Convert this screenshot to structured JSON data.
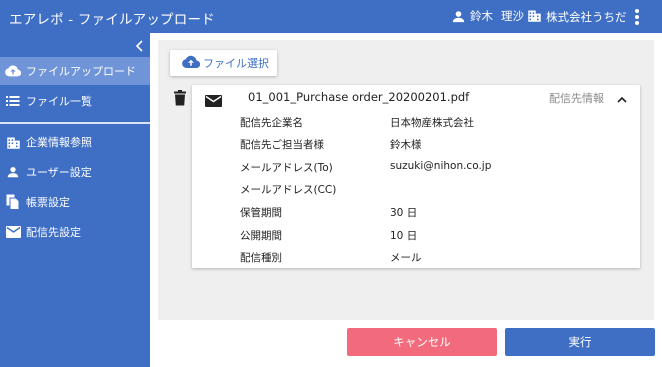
{
  "header": {
    "title": "エアレポ - ファイルアップロード",
    "user_last_name": "鈴木",
    "user_first_name": "理沙",
    "company": "株式会社うちだ"
  },
  "sidebar": {
    "items": [
      {
        "label": "ファイルアップロード",
        "icon": "cloud-upload-icon",
        "active": true
      },
      {
        "label": "ファイル一覧",
        "icon": "list-icon",
        "active": false
      },
      {
        "label": "企業情報参照",
        "icon": "building-icon",
        "active": false
      },
      {
        "label": "ユーザー設定",
        "icon": "person-icon",
        "active": false
      },
      {
        "label": "帳票設定",
        "icon": "documents-icon",
        "active": false
      },
      {
        "label": "配信先設定",
        "icon": "mail-icon",
        "active": false
      }
    ]
  },
  "upload": {
    "file_select_label": "ファイル選択"
  },
  "file_card": {
    "file_name": "01_001_Purchase order_20200201.pdf",
    "info_label": "配信先情報",
    "rows": [
      {
        "label": "配信先企業名",
        "value": "日本物産株式会社"
      },
      {
        "label": "配信先ご担当者様",
        "value": "鈴木様"
      },
      {
        "label": "メールアドレス(To)",
        "value": "suzuki@nihon.co.jp"
      },
      {
        "label": "メールアドレス(CC)",
        "value": ""
      },
      {
        "label": "保管期間",
        "value": "30 日"
      },
      {
        "label": "公開期間",
        "value": "10 日"
      },
      {
        "label": "配信種別",
        "value": "メール"
      }
    ]
  },
  "actions": {
    "cancel_label": "キャンセル",
    "run_label": "実行"
  },
  "colors": {
    "primary": "#3f6fc4",
    "sidebar_active": "#6f95d8",
    "cancel": "#f26b7d",
    "panel_bg": "#efefef"
  }
}
